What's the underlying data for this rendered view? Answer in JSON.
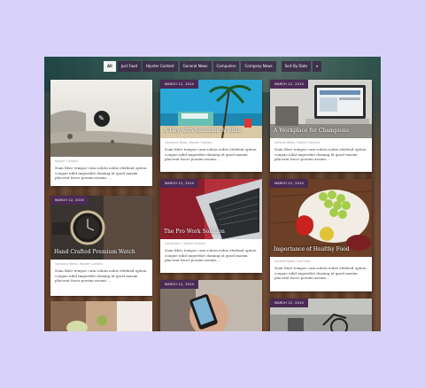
{
  "toolbar": {
    "filters": [
      "All",
      "Just Food",
      "Hipster Content",
      "General News",
      "Computers",
      "Company News"
    ],
    "sort_label": "Sort By Date",
    "arrow_glyph": "▾"
  },
  "excerpt_lines": [
    "Nam liber tempor cum soluta nobis eleifend option",
    "congue nihil imperdiet doming id quod mazim",
    "placerat facer possim assum...."
  ],
  "cards": {
    "beach": {
      "meta": "Hipster Content",
      "icon_glyph": "✎"
    },
    "sunshine": {
      "date": "MARCH 12, 2014",
      "title": "A Day with Sunshine & Bliss",
      "meta": "Company News, Hipster Content"
    },
    "workplace": {
      "date": "MARCH 12, 2014",
      "title": "A Workplace for Champions",
      "meta": "General News, Hipster Content"
    },
    "watch": {
      "date": "MARCH 12, 2014",
      "title": "Hand Crafted Premium Watch",
      "meta": "Company News, Hipster Content"
    },
    "prowork": {
      "date": "MARCH 12, 2014",
      "title": "The Pro Work Solution",
      "meta": "Computers, Hipster Content"
    },
    "food": {
      "date": "MARCH 12, 2014",
      "title": "Importance of Healthy Food",
      "meta": "General News, Just Food"
    },
    "drink": {},
    "phone": {
      "date": "MARCH 12, 2014"
    },
    "bike": {
      "date": "MARCH 12, 2014"
    }
  }
}
